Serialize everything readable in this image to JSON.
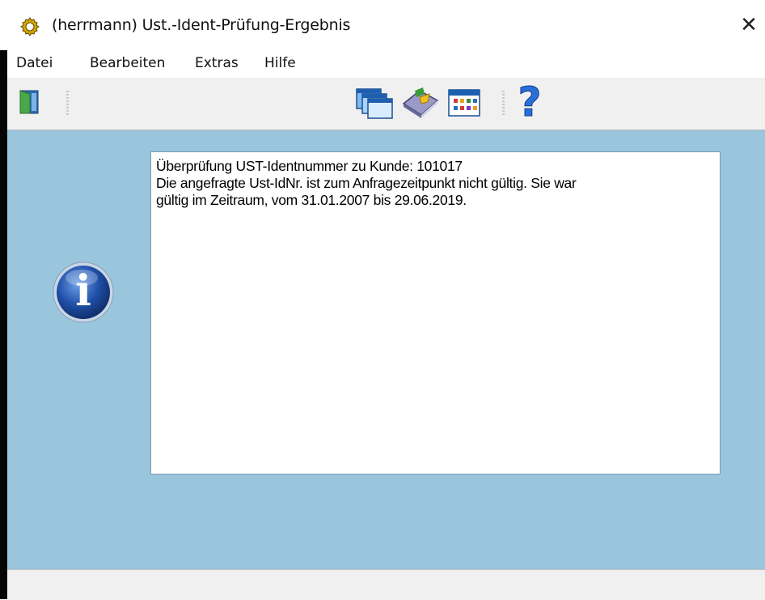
{
  "window": {
    "title": "(herrmann) Ust.-Ident-Prüfung-Ergebnis",
    "close_label": "✕",
    "app_icon": "gear-icon"
  },
  "menu": {
    "items": [
      {
        "label": "Datei"
      },
      {
        "label": "Bearbeiten"
      },
      {
        "label": "Extras"
      },
      {
        "label": "Hilfe"
      }
    ]
  },
  "toolbar": {
    "buttons": [
      {
        "icon": "exit-door-icon"
      },
      {
        "icon": "windows-cascade-icon"
      },
      {
        "icon": "book-icon"
      },
      {
        "icon": "calendar-grid-icon"
      },
      {
        "icon": "help-question-icon",
        "glyph": "?"
      }
    ]
  },
  "message": {
    "icon": "info-icon",
    "info_glyph": "i",
    "lines": [
      "Überprüfung UST-Identnummer zu Kunde: 101017",
      "Die angefragte Ust-IdNr. ist zum Anfragezeitpunkt nicht gültig. Sie war",
      "gültig im Zeitraum, vom 31.01.2007 bis 29.06.2019."
    ]
  },
  "colors": {
    "content_bg": "#99c5dd",
    "toolbar_bg": "#f0f0f0",
    "info_blue": "#1f4fa8"
  }
}
